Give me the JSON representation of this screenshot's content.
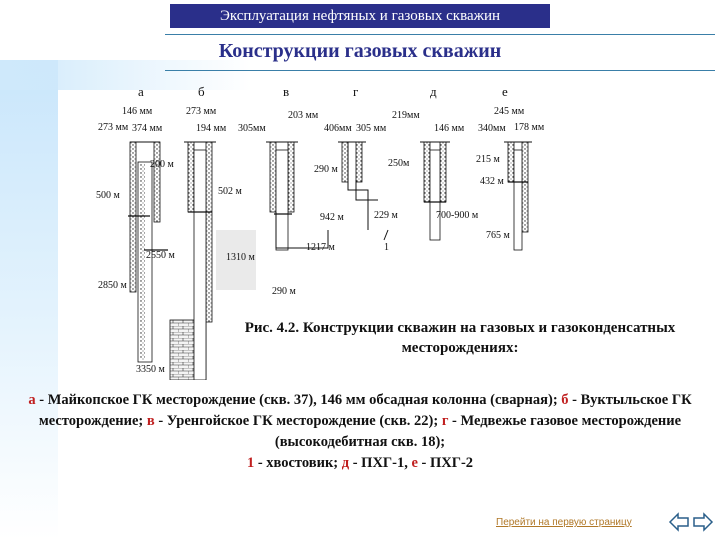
{
  "header": {
    "text": "Эксплуатация нефтяных и газовых скважин"
  },
  "title": "Конструкции газовых скважин",
  "figure": {
    "columns": [
      "а",
      "б",
      "в",
      "г",
      "д",
      "е"
    ],
    "labels": {
      "a_diam1": "146 мм",
      "a_diam2": "273 мм",
      "a_diam3": "374 мм",
      "a_d200": "200 м",
      "a_d500": "500 м",
      "a_d2550": "2550 м",
      "a_d2850": "2850 м",
      "a_d3350": "3350 м",
      "b_diam1": "273 мм",
      "b_diam2": "194 мм",
      "b_diam3": "305мм",
      "b_d502": "502 м",
      "b_d1310": "1310 м",
      "b_d290": "290 м",
      "v_diam1": "203 мм",
      "v_diam2": "406мм",
      "v_diam3": "305 мм",
      "v_d290": "290 м",
      "v_d942": "942 м",
      "v_d1217": "1217 м",
      "g_diam1": "219мм",
      "g_diam2": "146 мм",
      "g_d250": "250м",
      "g_d229": "229 м",
      "d_diam1": "340мм",
      "d_d700": "700-900 м",
      "e_diam1": "245 мм",
      "e_diam2": "178 мм",
      "e_d215": "215 м",
      "e_d432": "432 м",
      "e_d765": "765 м",
      "tail_mark": "1"
    }
  },
  "caption": "Рис. 4.2. Конструкции скважин на газовых и газоконденсатных месторождениях:",
  "legend": {
    "a_key": "а",
    "a_text": " - Майкопское ГК месторождение (скв. 37), 146 мм обсадная колонна (сварная); ",
    "b_key": "б",
    "b_text": " - Вуктыльское ГК месторождение; ",
    "v_key": "в",
    "v_text": " - Уренгойское ГК месторождение (скв. 22); ",
    "g_key": "г",
    "g_text": " - Медвежье газовое месторождение (высокодебитная скв. 18);",
    "one_key": "1",
    "one_text": " - хвостовик; ",
    "d_key": "д",
    "d_text": " - ПХГ-1, ",
    "e_key": "е",
    "e_text": " - ПХГ-2"
  },
  "nav": {
    "first_page_link": "Перейти на первую страницу"
  },
  "colors": {
    "header_bg": "#2a2f8a",
    "title": "#2a2f8a",
    "legend_key": "#c02020",
    "link": "#b07828"
  }
}
